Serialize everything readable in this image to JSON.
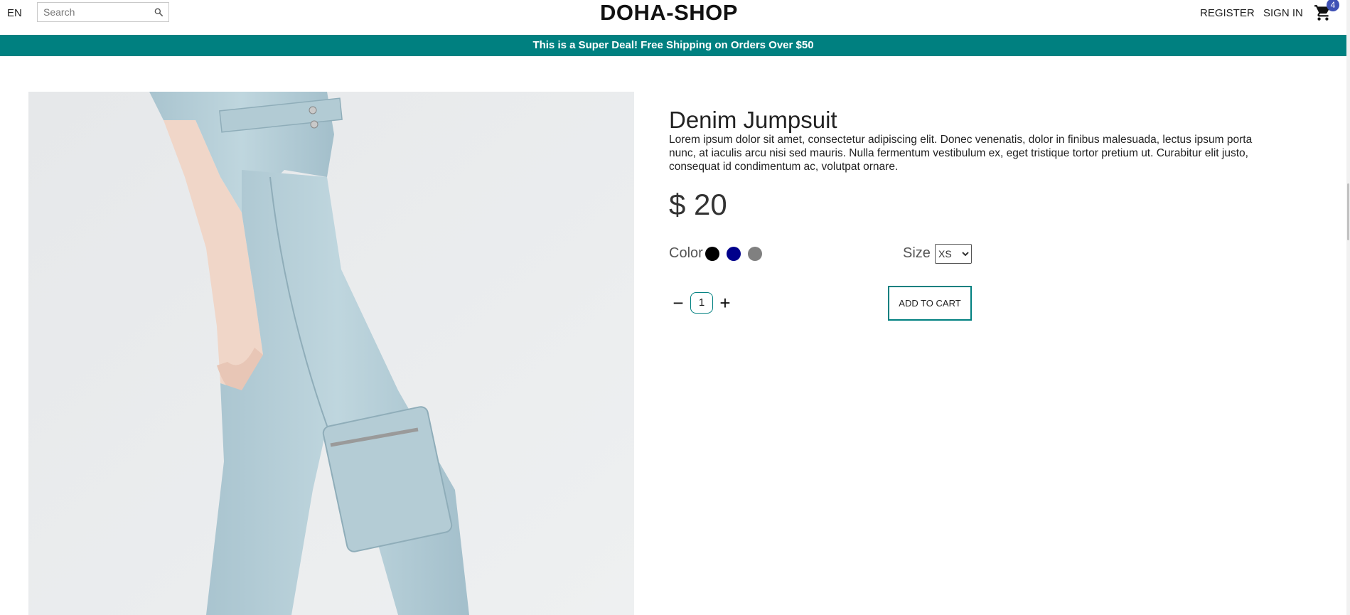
{
  "header": {
    "language": "EN",
    "search_placeholder": "Search",
    "logo": "DOHA-SHOP",
    "register": "REGISTER",
    "sign_in": "SIGN IN",
    "cart_count": "4",
    "search_icon": "search-icon",
    "cart_icon": "cart-icon"
  },
  "promo": {
    "text": "This is a Super Deal! Free Shipping on Orders Over $50"
  },
  "product": {
    "title": "Denim Jumpsuit",
    "description": "Lorem ipsum dolor sit amet, consectetur adipiscing elit. Donec venenatis, dolor in finibus malesuada, lectus ipsum porta nunc, at iaculis arcu nisi sed mauris. Nulla fermentum vestibulum ex, eget tristique tortor pretium ut. Curabitur elit justo, consequat id condimentum ac, volutpat ornare.",
    "price": "$ 20",
    "color_label": "Color",
    "colors": [
      "#000000",
      "#00008b",
      "#808080"
    ],
    "size_label": "Size",
    "size_selected": "XS",
    "quantity": "1",
    "add_to_cart": "ADD TO CART"
  },
  "theme": {
    "accent": "#008080",
    "badge": "#3f51b5"
  }
}
